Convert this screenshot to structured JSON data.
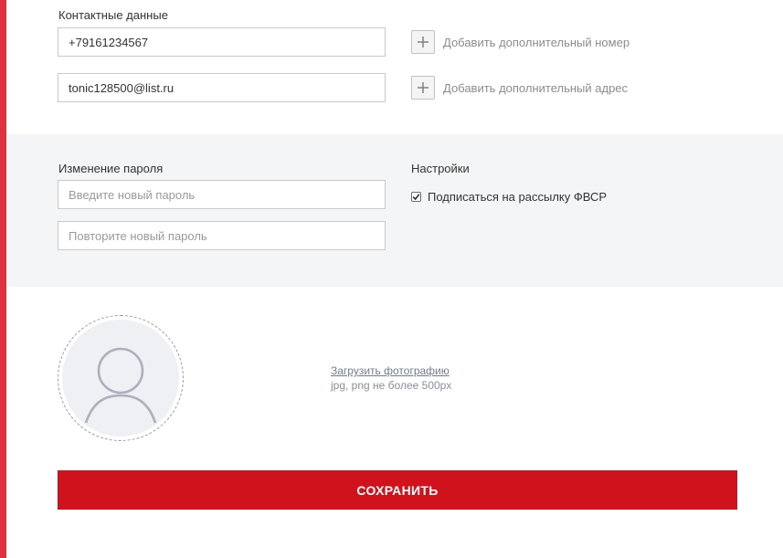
{
  "colors": {
    "accent": "#e0313d",
    "save_button": "#d0121d",
    "band": "#f4f5f6",
    "link": "#6f7d91"
  },
  "contacts": {
    "label": "Контактные данные",
    "phone_value": "+79161234567",
    "add_phone_label": "Добавить дополнительный номер",
    "email_value": "tonic128500@list.ru",
    "add_email_label": "Добавить дополнительный адрес",
    "add_icon": "plus-icon"
  },
  "password": {
    "label": "Изменение пароля",
    "new_placeholder": "Введите новый пароль",
    "repeat_placeholder": "Повторите новый пароль"
  },
  "settings": {
    "label": "Настройки",
    "subscribe_label": "Подписаться на рассылку ФВСР",
    "subscribe_checked": true
  },
  "photo": {
    "avatar_icon": "user-placeholder-icon",
    "upload_link": "Загрузить фотографию",
    "upload_hint": "jpg, png не более 500px"
  },
  "actions": {
    "save_label": "СОХРАНИТЬ"
  }
}
